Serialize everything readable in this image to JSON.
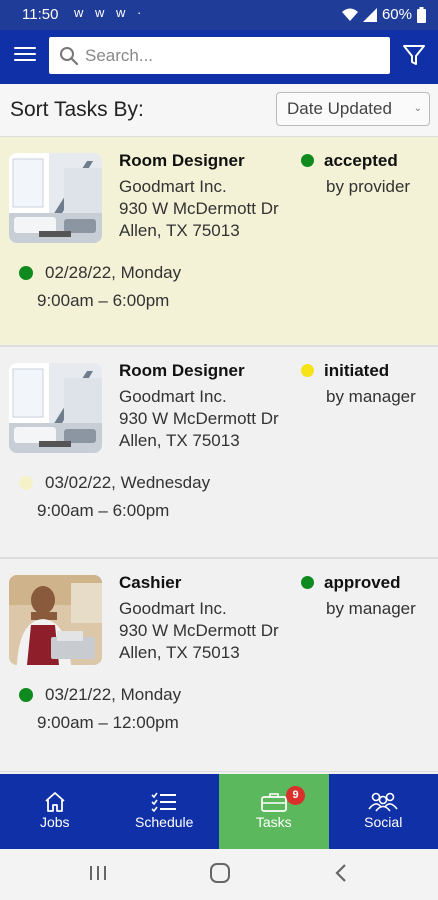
{
  "status_bar": {
    "time": "11:50",
    "notifications": "ᴡ ᴡ ᴡ ·",
    "battery": "60%"
  },
  "search": {
    "placeholder": "Search..."
  },
  "sort": {
    "label": "Sort Tasks By:",
    "selected": "Date Updated"
  },
  "tasks": [
    {
      "title": "Room Designer",
      "company": "Goodmart Inc.",
      "address1": "930 W McDermott Dr",
      "address2": "Allen, TX 75013",
      "status": "accepted",
      "status_by": "by provider",
      "status_color": "#0f8a1f",
      "date": "02/28/22, Monday",
      "hours": "9:00am – 6:00pm",
      "date_color": "#0f8a1f",
      "thumb": "room",
      "bg": "#f3f1d6"
    },
    {
      "title": "Room Designer",
      "company": "Goodmart Inc.",
      "address1": "930 W McDermott Dr",
      "address2": "Allen, TX 75013",
      "status": "initiated",
      "status_by": "by manager",
      "status_color": "#f5e316",
      "date": "03/02/22, Wednesday",
      "hours": "9:00am – 6:00pm",
      "date_color": "#f5f2c9",
      "thumb": "room",
      "bg": "#f1f1f1"
    },
    {
      "title": "Cashier",
      "company": "Goodmart Inc.",
      "address1": "930 W McDermott Dr",
      "address2": "Allen, TX 75013",
      "status": "approved",
      "status_by": "by manager",
      "status_color": "#0f8a1f",
      "date": "03/21/22, Monday",
      "hours": "9:00am – 12:00pm",
      "date_color": "#0f8a1f",
      "thumb": "cashier",
      "bg": "#f1f1f1"
    }
  ],
  "bottom_nav": [
    {
      "label": "Jobs",
      "icon": "home-icon"
    },
    {
      "label": "Schedule",
      "icon": "checklist-icon"
    },
    {
      "label": "Tasks",
      "icon": "briefcase-icon",
      "badge": "9",
      "active": true
    },
    {
      "label": "Social",
      "icon": "people-icon"
    }
  ],
  "colors": {
    "brand_blue": "#0f30a6",
    "active_green": "#5cb85c"
  }
}
